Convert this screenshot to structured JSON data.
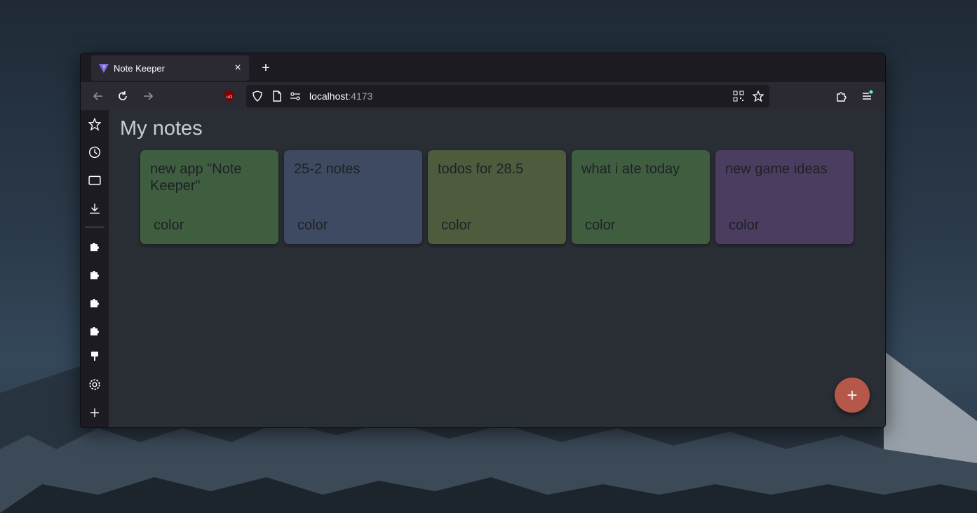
{
  "browser": {
    "tab": {
      "title": "Note Keeper",
      "favicon": "vite-logo-icon"
    },
    "url": {
      "host": "localhost",
      "port": ":4173"
    }
  },
  "page": {
    "title": "My notes",
    "notes": [
      {
        "title": "new app \"Note Keeper\"",
        "color_label": "color",
        "bg": "#3f5e3f"
      },
      {
        "title": "25-2 notes",
        "color_label": "color",
        "bg": "#3d4a61"
      },
      {
        "title": "todos for 28.5",
        "color_label": "color",
        "bg": "#4e5b3d"
      },
      {
        "title": "what i ate today",
        "color_label": "color",
        "bg": "#3f5e3f"
      },
      {
        "title": "new game ideas",
        "color_label": "color",
        "bg": "#4b3d5f"
      }
    ],
    "fab_label": "+"
  },
  "colors": {
    "accent": "#b5584a",
    "ublock": "#800000"
  }
}
